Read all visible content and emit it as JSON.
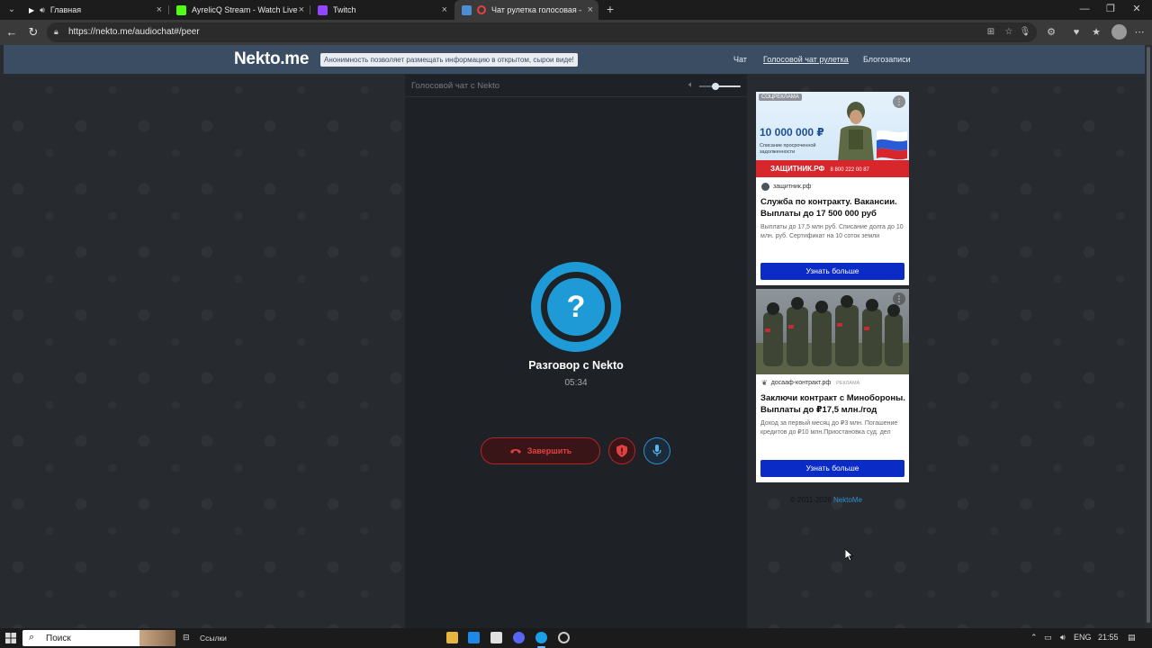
{
  "browser": {
    "tabs": [
      {
        "title": "Главная",
        "active": false
      },
      {
        "title": "AyrelicQ Stream - Watch Live on K",
        "active": false
      },
      {
        "title": "Twitch",
        "active": false
      },
      {
        "title": "Чат рулетка голосовая — N",
        "active": true
      }
    ],
    "url": "https://nekto.me/audiochat#/peer"
  },
  "site": {
    "logo": "Nekto.me",
    "tagline": "Анонимность позволяет размещать информацию в открытом, сырои виде!",
    "nav": [
      "Чат",
      "Голосовой чат рулетка",
      "Блогозаписи"
    ]
  },
  "chat": {
    "panel_title": "Голосовой чат с Nekto",
    "volume_level": 0.4,
    "avatar_symbol": "?",
    "conversation_title": "Разговор с Nekto",
    "timer": "05:34",
    "end_button_label": "Завершить"
  },
  "ads": [
    {
      "badge": "СОЦРЕКЛАМА",
      "banner_amount": "10 000 000 ₽",
      "banner_sub": "Списание просроченной задолженности",
      "banner_brand": "ЗАЩИТНИК.РФ",
      "banner_phone": "8 800 222 00 87",
      "source": "защитник.рф",
      "source_tag": "",
      "headline": "Служба по контракту. Вакансии. Выплаты до 17 500 000 руб",
      "body": "Выплаты до 17,5 млн руб. Списание долга до 10 млн. руб. Сертификат на 10 соток земли",
      "cta": "Узнать больше"
    },
    {
      "badge": "",
      "source": "досааф-контракт.рф",
      "source_tag": "РЕКЛАМА",
      "headline": "Заключи контракт с Минобороны. Выплаты до ₽17,5 млн./год",
      "body": "Доход за первый месяц до ₽3 млн. Погашение кредитов до ₽10 млн.Приостановка суд. дел",
      "cta": "Узнать больше"
    }
  ],
  "footer": {
    "copyright": "© 2011-2026",
    "link": "NektoMe"
  },
  "taskbar": {
    "search_placeholder": "Поиск",
    "widget_label": "Ссылки",
    "lang": "ENG",
    "time": "21:55"
  },
  "colors": {
    "accent": "#1e9bd7",
    "danger": "#e34141",
    "header": "#3a4d63",
    "cta": "#0b2bc7"
  }
}
